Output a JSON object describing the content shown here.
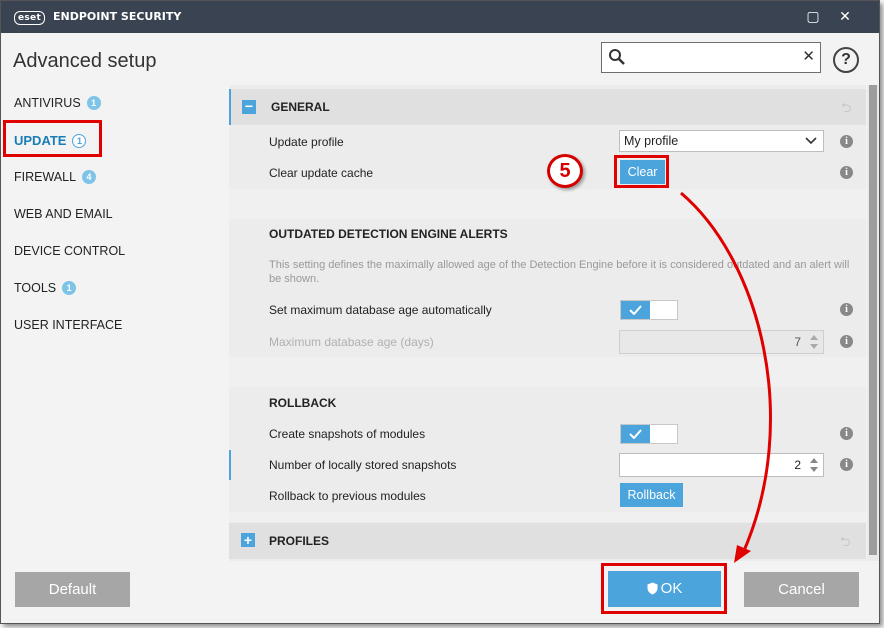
{
  "titlebar": {
    "logo_text": "eset",
    "app_title": "ENDPOINT SECURITY",
    "minimize_glyph": "▢",
    "close_glyph": "✕"
  },
  "header": {
    "page_title": "Advanced setup",
    "search": {
      "value": "",
      "placeholder": "",
      "clear_glyph": "✕"
    },
    "help_glyph": "?"
  },
  "sidebar": {
    "items": [
      {
        "label": "ANTIVIRUS",
        "badge": "1"
      },
      {
        "label": "UPDATE",
        "badge": "1"
      },
      {
        "label": "FIREWALL",
        "badge": "4"
      },
      {
        "label": "WEB AND EMAIL",
        "badge": ""
      },
      {
        "label": "DEVICE CONTROL",
        "badge": ""
      },
      {
        "label": "TOOLS",
        "badge": "1"
      },
      {
        "label": "USER INTERFACE",
        "badge": ""
      }
    ]
  },
  "general": {
    "title": "GENERAL",
    "collapse_glyph": "−",
    "revert_glyph": "⮌",
    "update_profile_label": "Update profile",
    "update_profile_value": "My profile",
    "clear_cache_label": "Clear update cache",
    "clear_button": "Clear",
    "step_number": "5"
  },
  "outdated": {
    "title": "OUTDATED DETECTION ENGINE ALERTS",
    "description": "This setting defines the maximally allowed age of the Detection Engine before it is considered outdated and an alert will be shown.",
    "auto_label": "Set maximum database age automatically",
    "auto_enabled": true,
    "max_age_label": "Maximum database age (days)",
    "max_age_value": "7"
  },
  "rollback": {
    "title": "ROLLBACK",
    "snapshots_label": "Create snapshots of modules",
    "snapshots_enabled": true,
    "count_label": "Number of locally stored snapshots",
    "count_value": "2",
    "rollback_label": "Rollback to previous modules",
    "rollback_button": "Rollback"
  },
  "profiles": {
    "title": "PROFILES",
    "expand_glyph": "+",
    "revert_glyph": "⮌"
  },
  "footer": {
    "default_button": "Default",
    "ok_button": "OK",
    "cancel_button": "Cancel"
  },
  "info_glyph": "i",
  "colors": {
    "titlebar": "#3a4351",
    "accent": "#4ba4dc",
    "annotation_red": "#e00000",
    "button_gray": "#a6a6a6"
  }
}
